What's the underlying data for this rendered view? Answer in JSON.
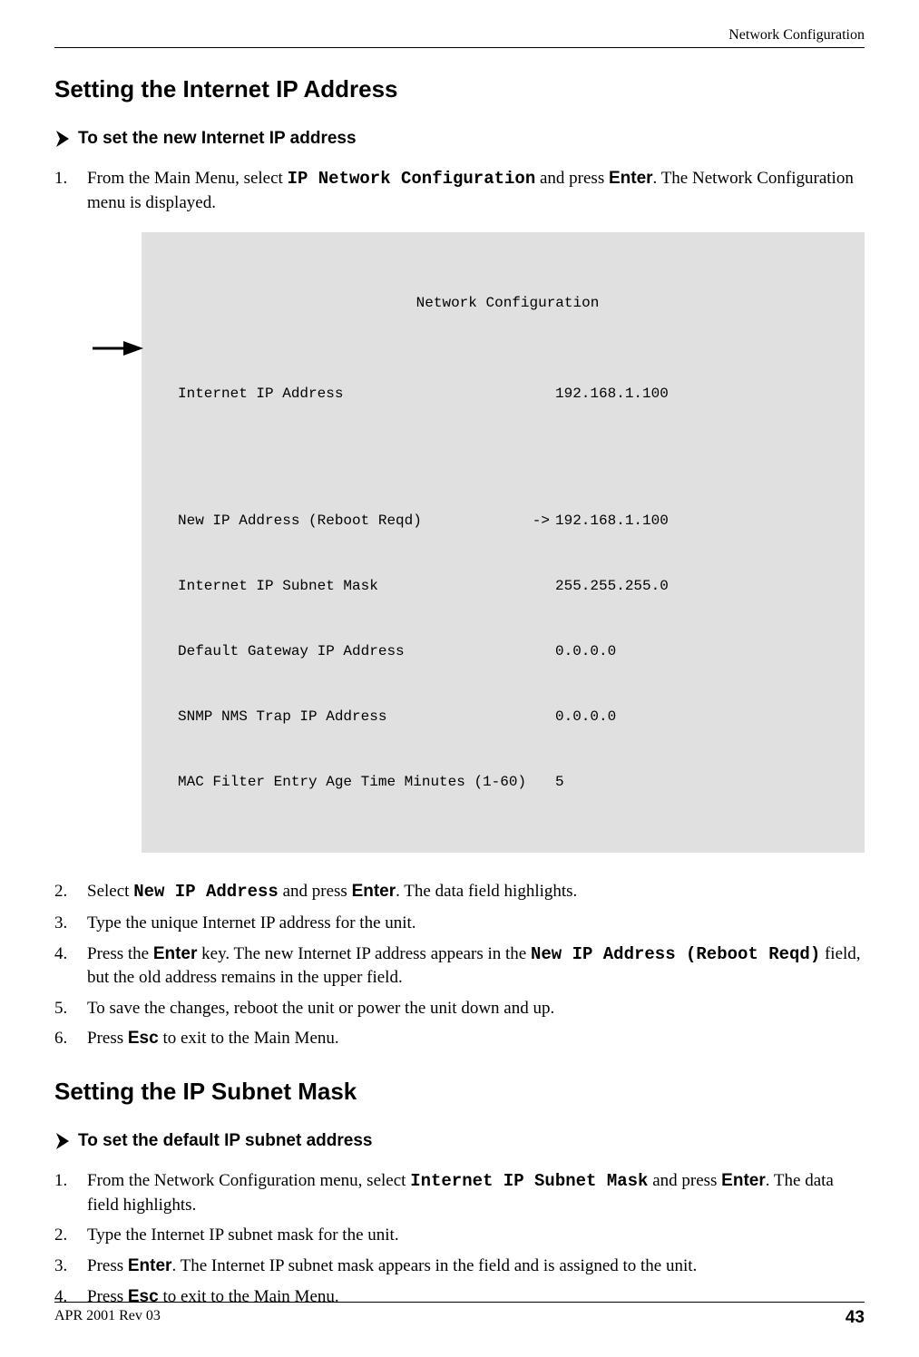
{
  "header": {
    "chapter": "Network Configuration"
  },
  "section1": {
    "heading": "Setting the Internet IP Address",
    "procedure_title": "To set the new Internet IP address",
    "step1_a": "From the Main Menu, select ",
    "step1_b": "IP Network Configuration",
    "step1_c": " and press ",
    "step1_d": "Enter",
    "step1_e": ". The Network Configuration menu is displayed.",
    "step2_a": "Select ",
    "step2_b": "New IP Address",
    "step2_c": " and press ",
    "step2_d": "Enter",
    "step2_e": ". The data field highlights.",
    "step3": "Type the unique Internet IP address for the unit.",
    "step4_a": "Press the ",
    "step4_b": "Enter",
    "step4_c": " key. The new Internet IP address appears in the ",
    "step4_d": "New IP Address (Reboot Reqd)",
    "step4_e": " field, but the old address remains in the upper field.",
    "step5": "To save the changes, reboot the unit or power the unit down and up.",
    "step6_a": "Press ",
    "step6_b": "Esc",
    "step6_c": " to exit to the Main Menu."
  },
  "terminal": {
    "title": "Network Configuration",
    "rows": [
      {
        "label": "Internet IP Address",
        "arrow": "",
        "value": "192.168.1.100"
      },
      {
        "label": "New IP Address (Reboot Reqd)",
        "arrow": "->",
        "value": "192.168.1.100"
      },
      {
        "label": "Internet IP Subnet Mask",
        "arrow": "",
        "value": "255.255.255.0"
      },
      {
        "label": "Default Gateway IP Address",
        "arrow": "",
        "value": "0.0.0.0"
      },
      {
        "label": "SNMP NMS Trap IP Address",
        "arrow": "",
        "value": "0.0.0.0"
      },
      {
        "label": "MAC Filter Entry Age Time Minutes (1-60)",
        "arrow": "",
        "value": "5"
      }
    ]
  },
  "section2": {
    "heading": "Setting the IP Subnet Mask",
    "procedure_title": "To set the default IP subnet address",
    "step1_a": "From the Network Configuration menu, select ",
    "step1_b": "Internet IP Subnet Mask",
    "step1_c": " and press ",
    "step1_d": "Enter",
    "step1_e": ". The data field highlights.",
    "step2": "Type the Internet IP subnet mask for the unit.",
    "step3_a": "Press ",
    "step3_b": "Enter",
    "step3_c": ". The Internet IP subnet mask appears in the field and is assigned to the unit.",
    "step4_a": "Press ",
    "step4_b": "Esc",
    "step4_c": " to exit to the Main Menu."
  },
  "footer": {
    "revision": "APR 2001 Rev 03",
    "page_number": "43"
  }
}
